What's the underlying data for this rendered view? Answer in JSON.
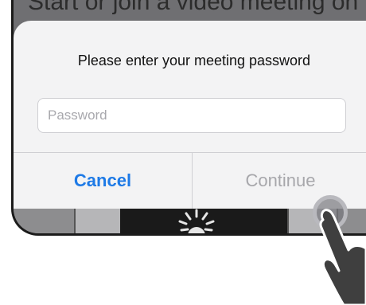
{
  "background": {
    "partial_text": "Start or join a video meeting on the"
  },
  "dialog": {
    "title": "Please enter your meeting password",
    "password_placeholder": "Password",
    "cancel_label": "Cancel",
    "continue_label": "Continue"
  },
  "colors": {
    "accent": "#1e7ae6",
    "disabled": "#a7a7ab",
    "dialog_bg": "#f3f3f4"
  },
  "icons": [
    "hand-pointer-icon",
    "tap-indicator-icon",
    "loading-spinner-icon"
  ]
}
